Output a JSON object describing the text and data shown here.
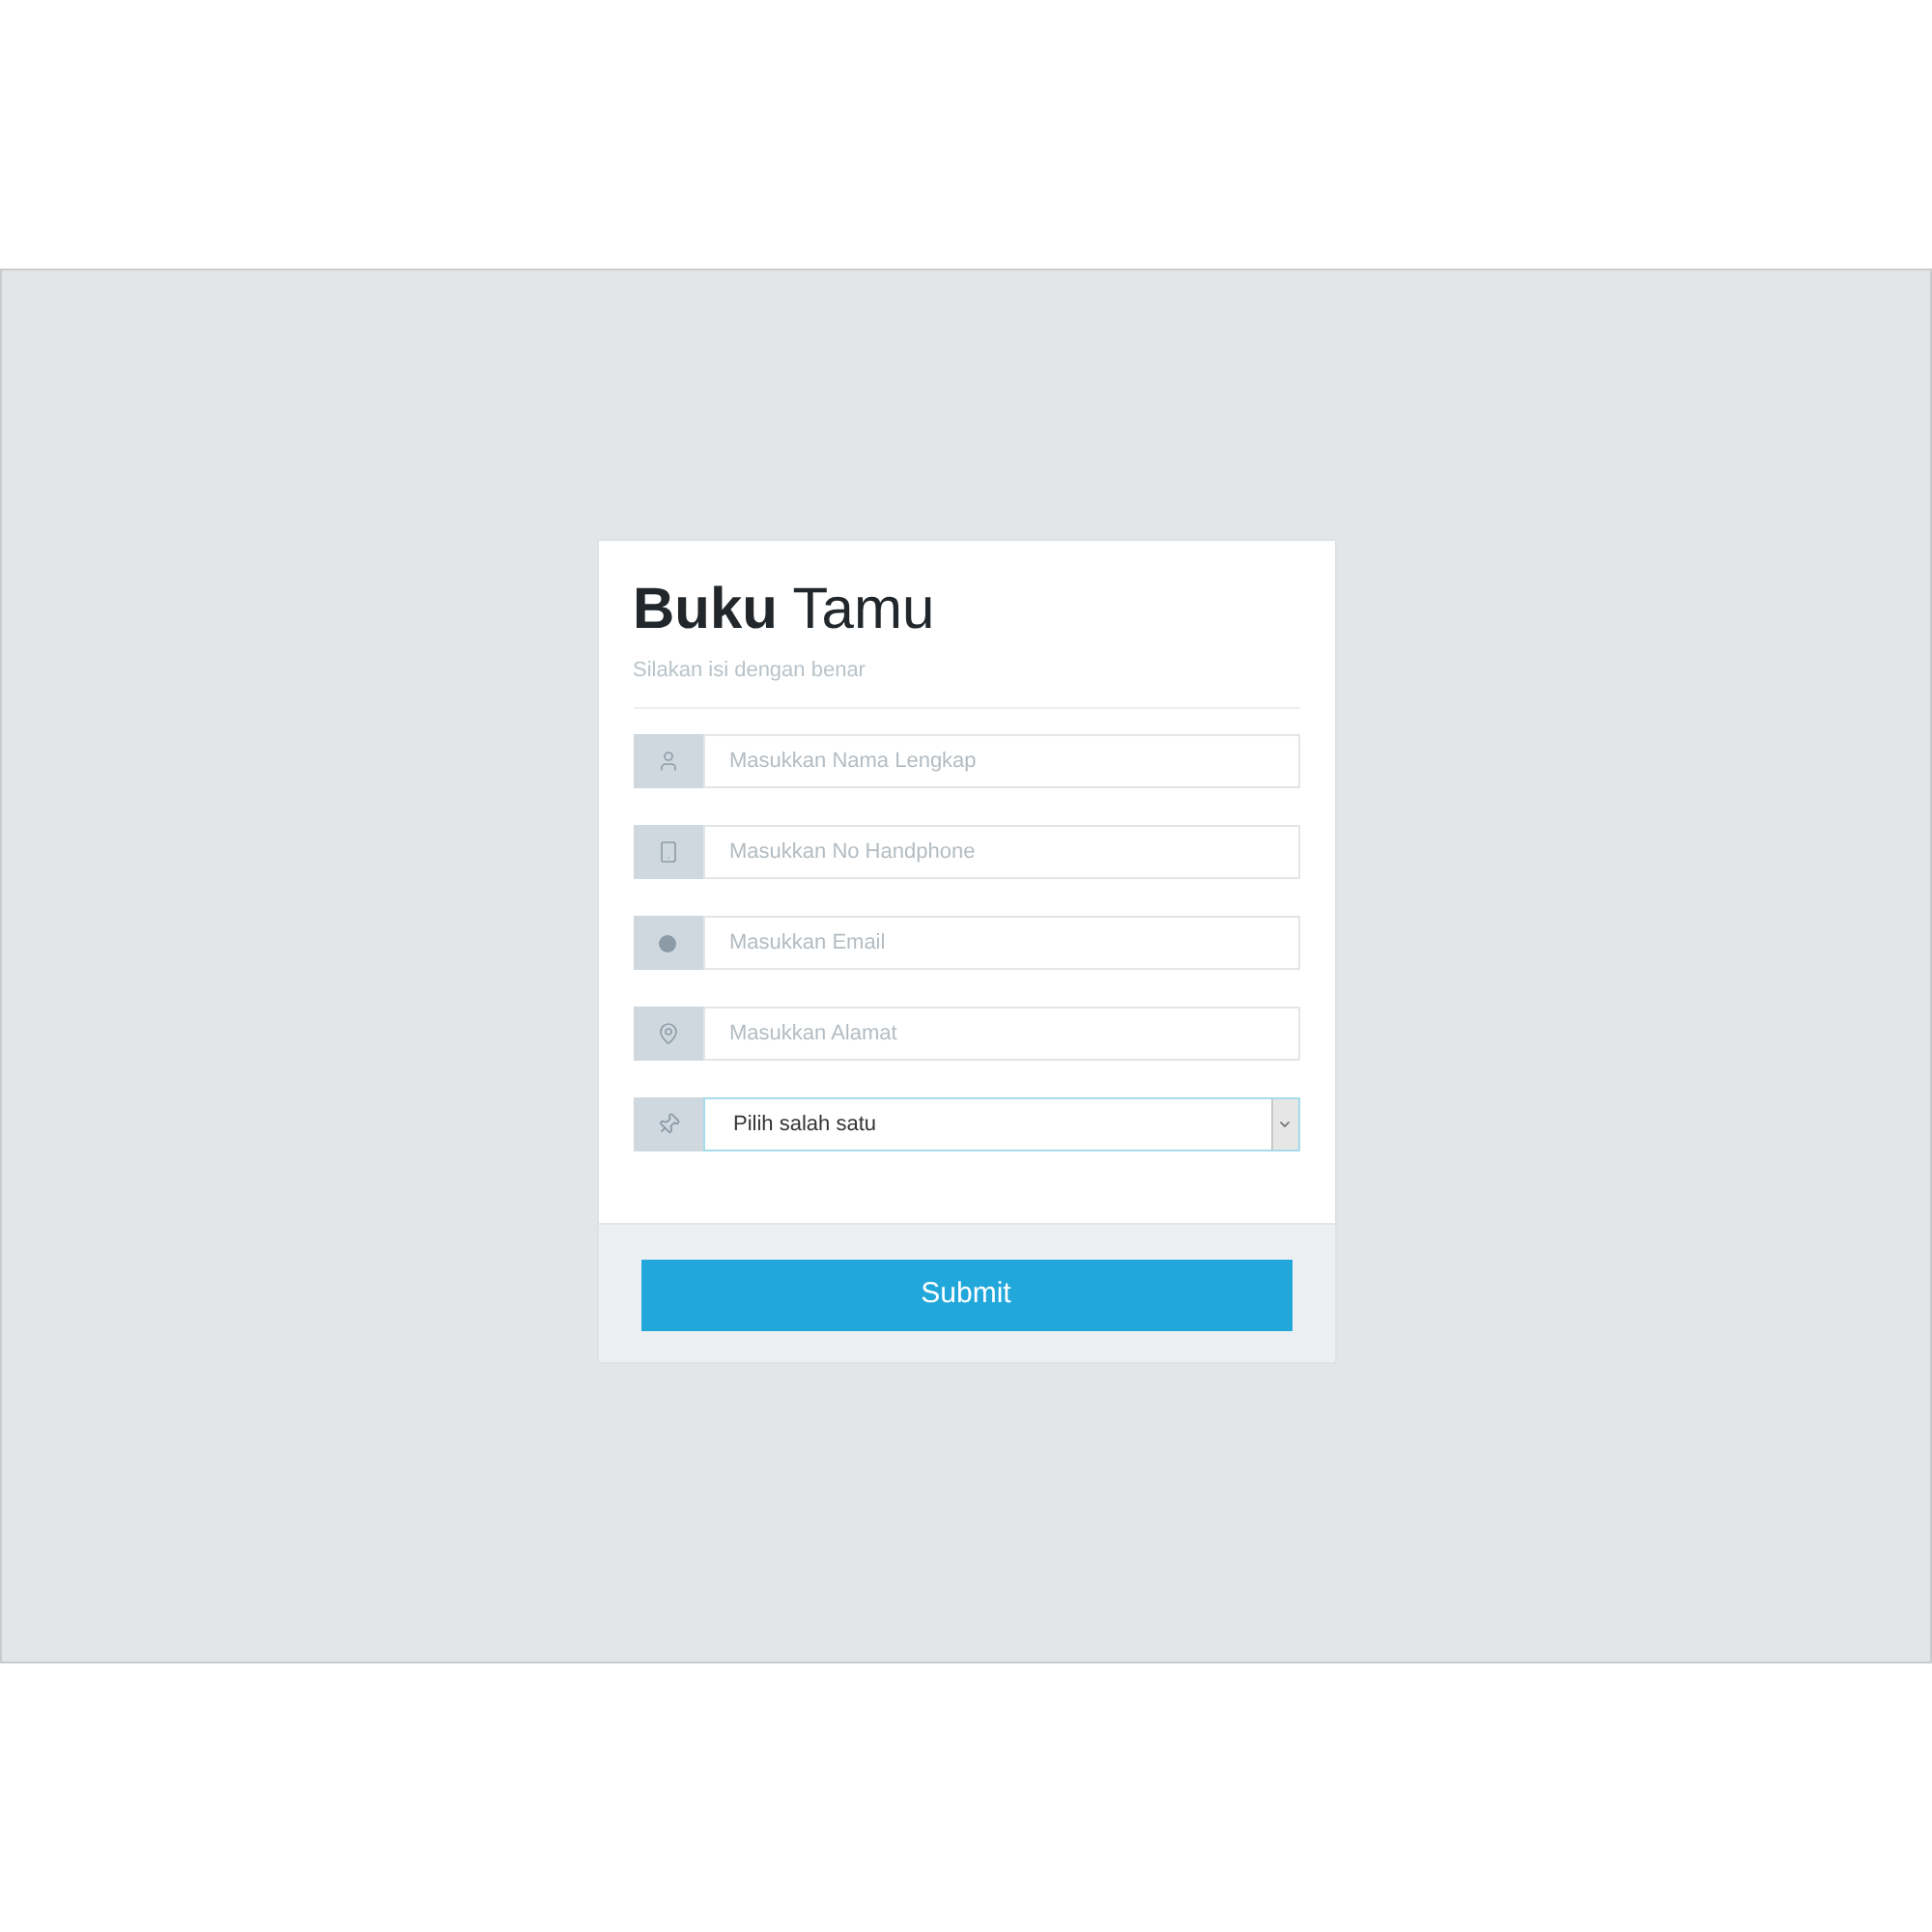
{
  "card": {
    "title": "**Buku** Tamu",
    "subtitle": "Silakan isi dengan benar",
    "fields": [
      {
        "kind": "name",
        "placeholder": "Masukkan Nama Lengkap",
        "focused": false
      },
      {
        "kind": "phone",
        "placeholder": "Masukkan No Handphone",
        "focused": false
      },
      {
        "kind": "email",
        "placeholder": "Masukkan Email",
        "focused": false
      },
      {
        "kind": "address",
        "placeholder": "Masukkan Alamat",
        "focused": false
      },
      {
        "kind": "choice",
        "value": "Pilih salah satu",
        "focused": true
      }
    ],
    "submit_button": "Submit"
  }
}
